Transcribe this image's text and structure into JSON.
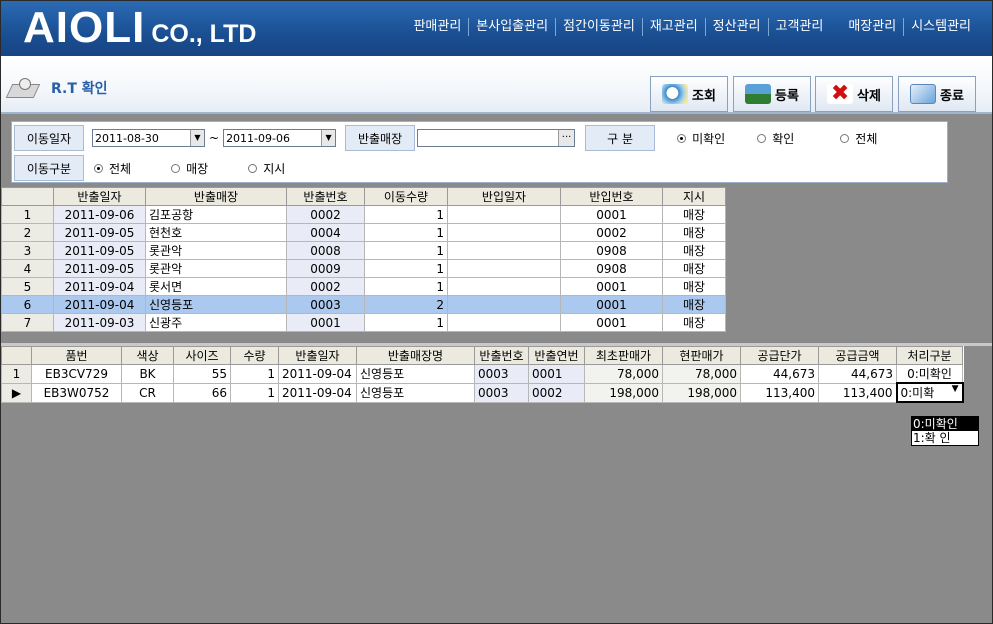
{
  "brand": {
    "main": "AIOLI",
    "suffix": "CO., LTD"
  },
  "menu": [
    "판매관리",
    "본사입출관리",
    "점간이동관리",
    "재고관리",
    "정산관리",
    "고객관리",
    "매장관리",
    "시스템관리"
  ],
  "title": "R.T 확인",
  "toolbar": {
    "search": "조회",
    "register": "등록",
    "delete": "삭제",
    "exit": "종료"
  },
  "filter": {
    "move_date_label": "이동일자",
    "date_from": "2011-08-30",
    "tilde": "~",
    "date_to": "2011-09-06",
    "store_label": "반출매장",
    "store_value": "",
    "ellipsis": "···",
    "kind_label": "구  분",
    "kind_options": [
      "미확인",
      "확인",
      "전체"
    ],
    "kind_selected": 0,
    "move_type_label": "이동구분",
    "move_type_options": [
      "전체",
      "매장",
      "지시"
    ],
    "move_type_selected": 0
  },
  "grid1": {
    "headers": [
      "반출일자",
      "반출매장",
      "반출번호",
      "이동수량",
      "반입일자",
      "반입번호",
      "지시"
    ],
    "rows": [
      [
        "1",
        "2011-09-06",
        "김포공항",
        "0002",
        "1",
        "",
        "0001",
        "매장"
      ],
      [
        "2",
        "2011-09-05",
        "현천호",
        "0004",
        "1",
        "",
        "0002",
        "매장"
      ],
      [
        "3",
        "2011-09-05",
        "롯관악",
        "0008",
        "1",
        "",
        "0908",
        "매장"
      ],
      [
        "4",
        "2011-09-05",
        "롯관악",
        "0009",
        "1",
        "",
        "0908",
        "매장"
      ],
      [
        "5",
        "2011-09-04",
        "롯서면",
        "0002",
        "1",
        "",
        "0001",
        "매장"
      ],
      [
        "6",
        "2011-09-04",
        "신영등포",
        "0003",
        "2",
        "",
        "0001",
        "매장"
      ],
      [
        "7",
        "2011-09-03",
        "신광주",
        "0001",
        "1",
        "",
        "0001",
        "매장"
      ]
    ],
    "selected_row": 5
  },
  "grid2": {
    "headers": [
      "품번",
      "색상",
      "사이즈",
      "수량",
      "반출일자",
      "반출매장명",
      "반출번호",
      "반출연번",
      "최초판매가",
      "현판매가",
      "공급단가",
      "공급금액",
      "처리구분"
    ],
    "rows": [
      [
        "1",
        "EB3CV729",
        "BK",
        "55",
        "1",
        "2011-09-04",
        "신영등포",
        "0003",
        "0001",
        "78,000",
        "78,000",
        "44,673",
        "44,673",
        "0:미확인"
      ],
      [
        "▶",
        "EB3W0752",
        "CR",
        "66",
        "1",
        "2011-09-04",
        "신영등포",
        "0003",
        "0002",
        "198,000",
        "198,000",
        "113,400",
        "113,400",
        "0:미확"
      ]
    ]
  },
  "dropdown": {
    "options": [
      "0:미확인",
      "1:확  인"
    ],
    "highlighted": 0
  },
  "colors": {
    "header_bg": "#1a4f93",
    "selected_row": "#abc8ee",
    "label_bg": "#e3ebf6"
  }
}
